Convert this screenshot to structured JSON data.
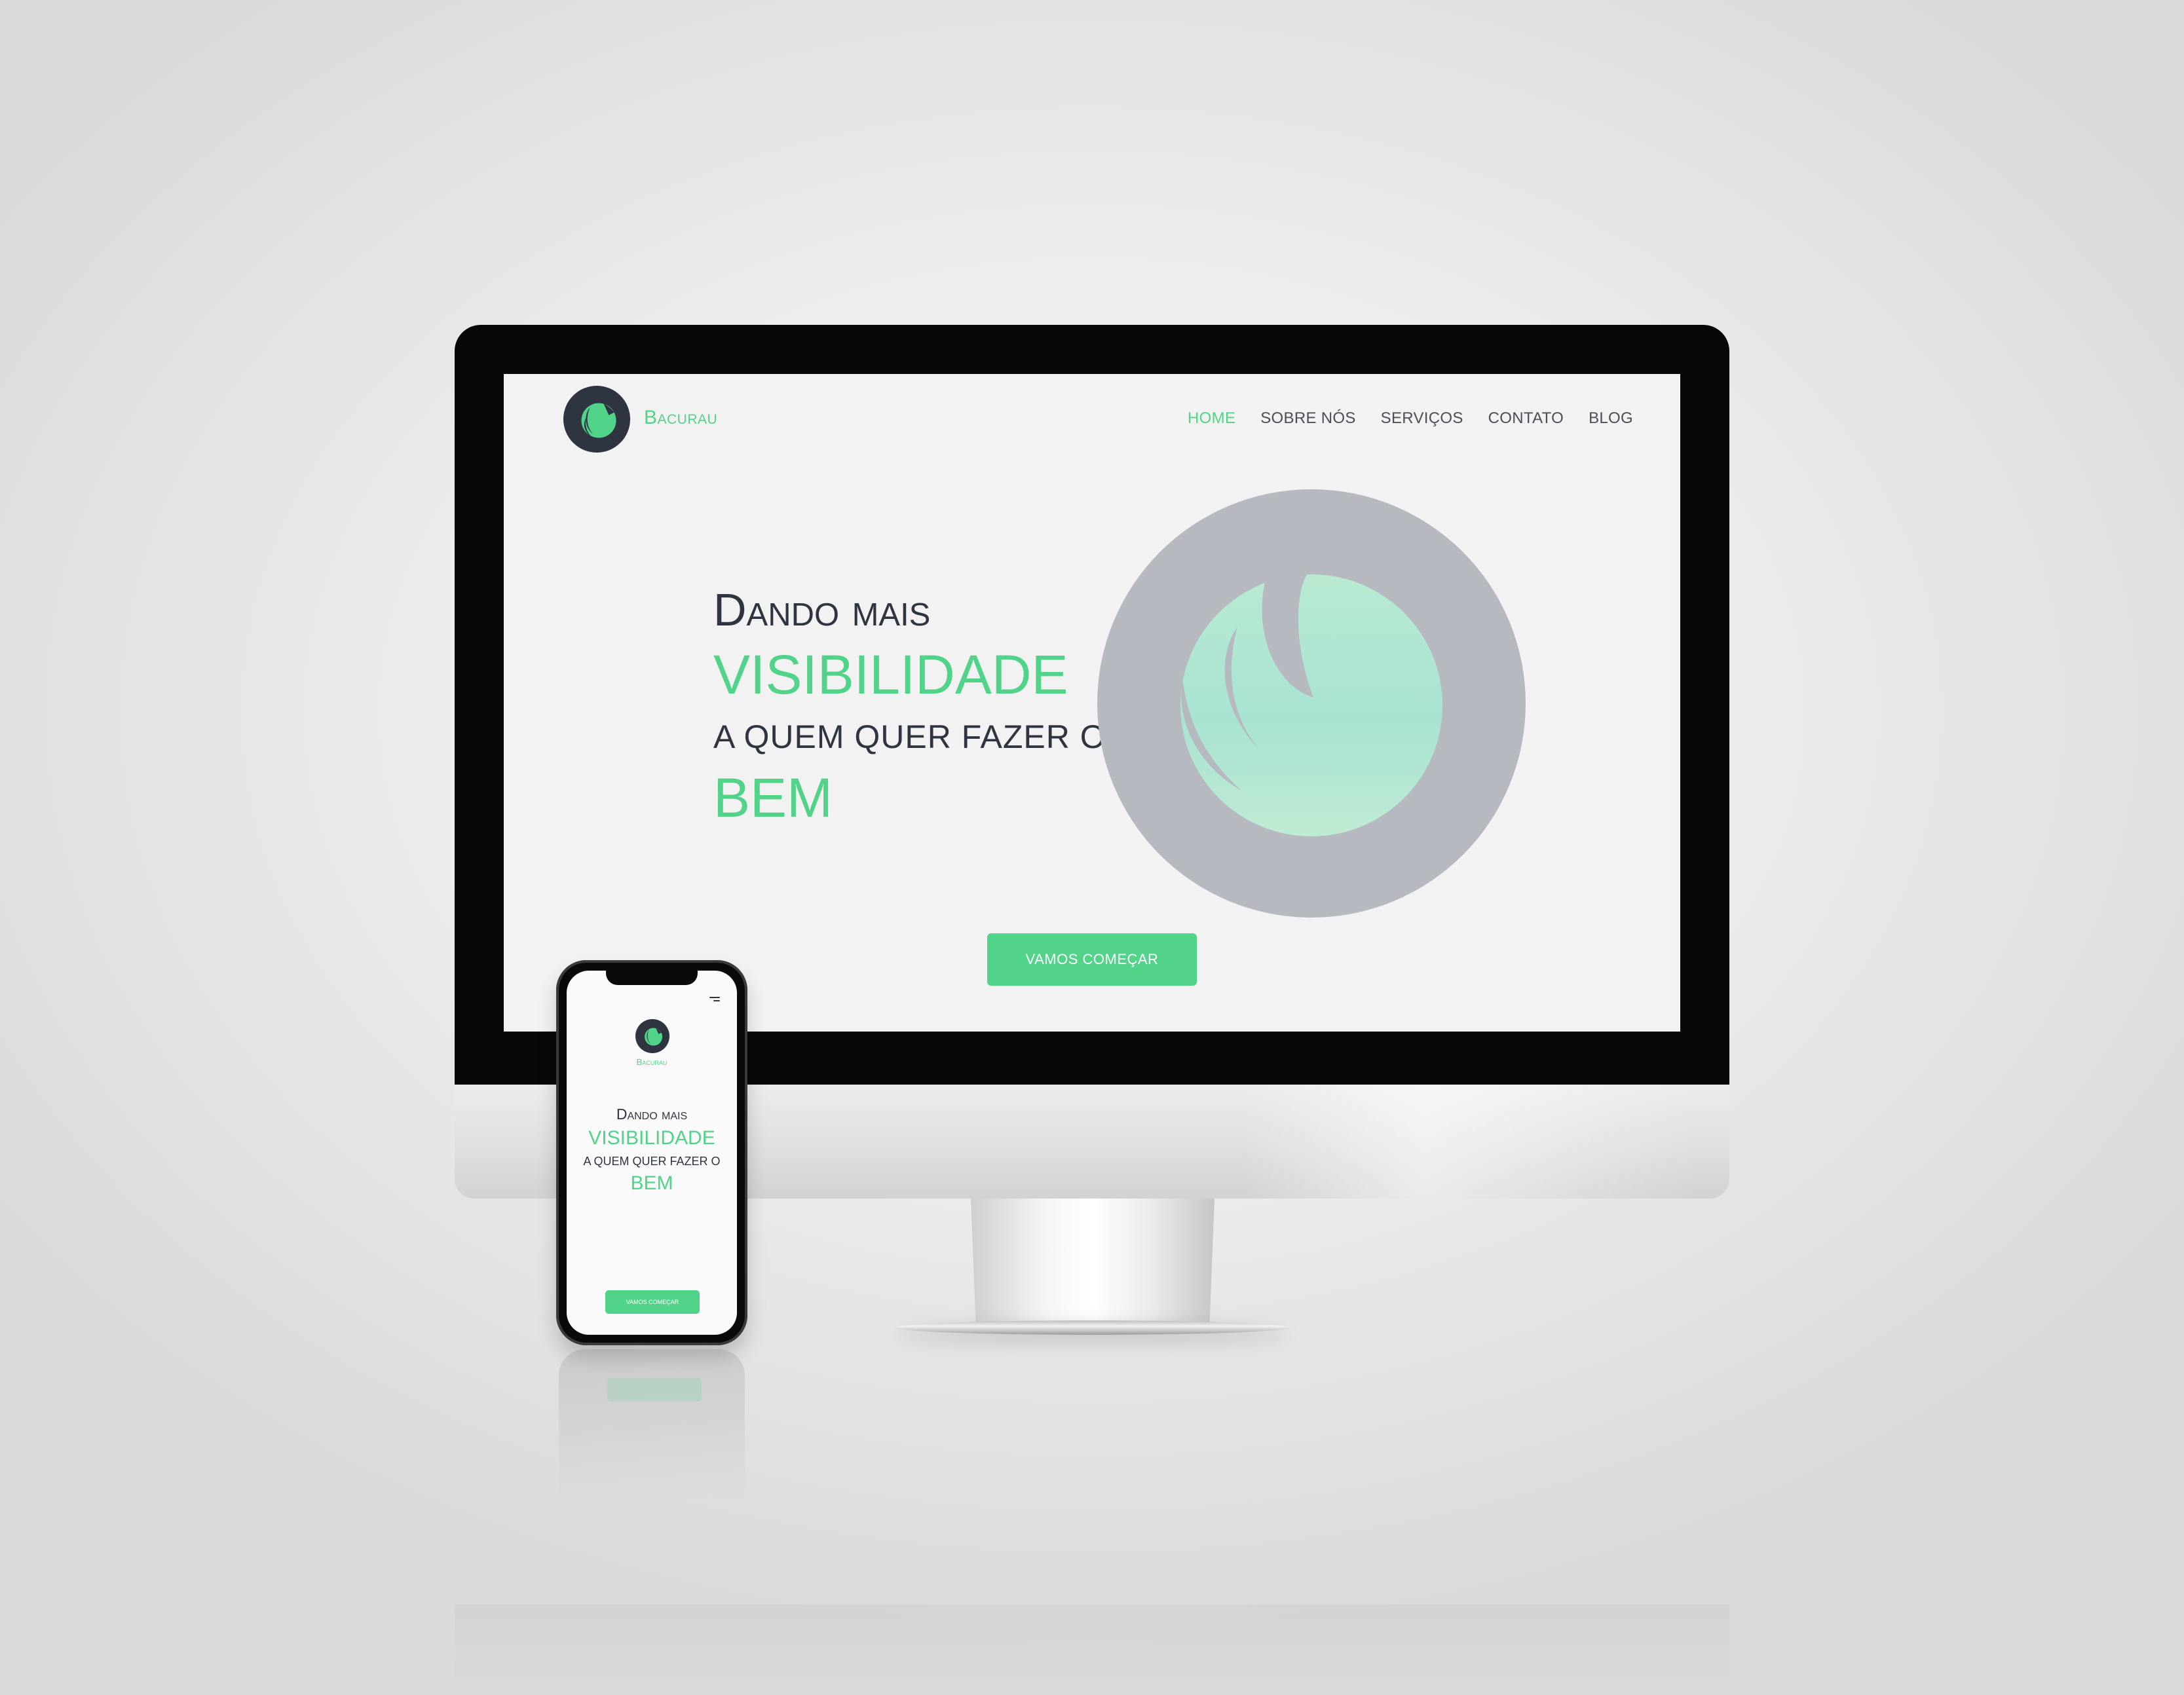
{
  "colors": {
    "accent": "#52d38a",
    "text_dark": "#2e3440",
    "logo_bg": "#2e3440",
    "art_circle": "#b6bac0",
    "screen_bg": "#f2f2f2"
  },
  "brand": {
    "name": "Bacurau",
    "logo_icon": "bird-logo-icon"
  },
  "nav": {
    "items": [
      {
        "label": "HOME",
        "active": true
      },
      {
        "label": "SOBRE NÓS",
        "active": false
      },
      {
        "label": "SERVIÇOS",
        "active": false
      },
      {
        "label": "CONTATO",
        "active": false
      },
      {
        "label": "BLOG",
        "active": false
      }
    ]
  },
  "hero": {
    "line1": "Dando mais",
    "line2": "VISIBILIDADE",
    "line3": "A QUEM QUER FAZER O",
    "line4": "BEM",
    "cta_label": "VAMOS COMEÇAR",
    "art_icon": "bird-illustration-icon"
  },
  "mobile": {
    "brand": "Bacurau",
    "line1": "Dando mais",
    "line2": "VISIBILIDADE",
    "line3": "A QUEM QUER FAZER O",
    "line4": "BEM",
    "cta_label": "VAMOS COMEÇAR",
    "menu_icon": "hamburger-menu-icon"
  }
}
